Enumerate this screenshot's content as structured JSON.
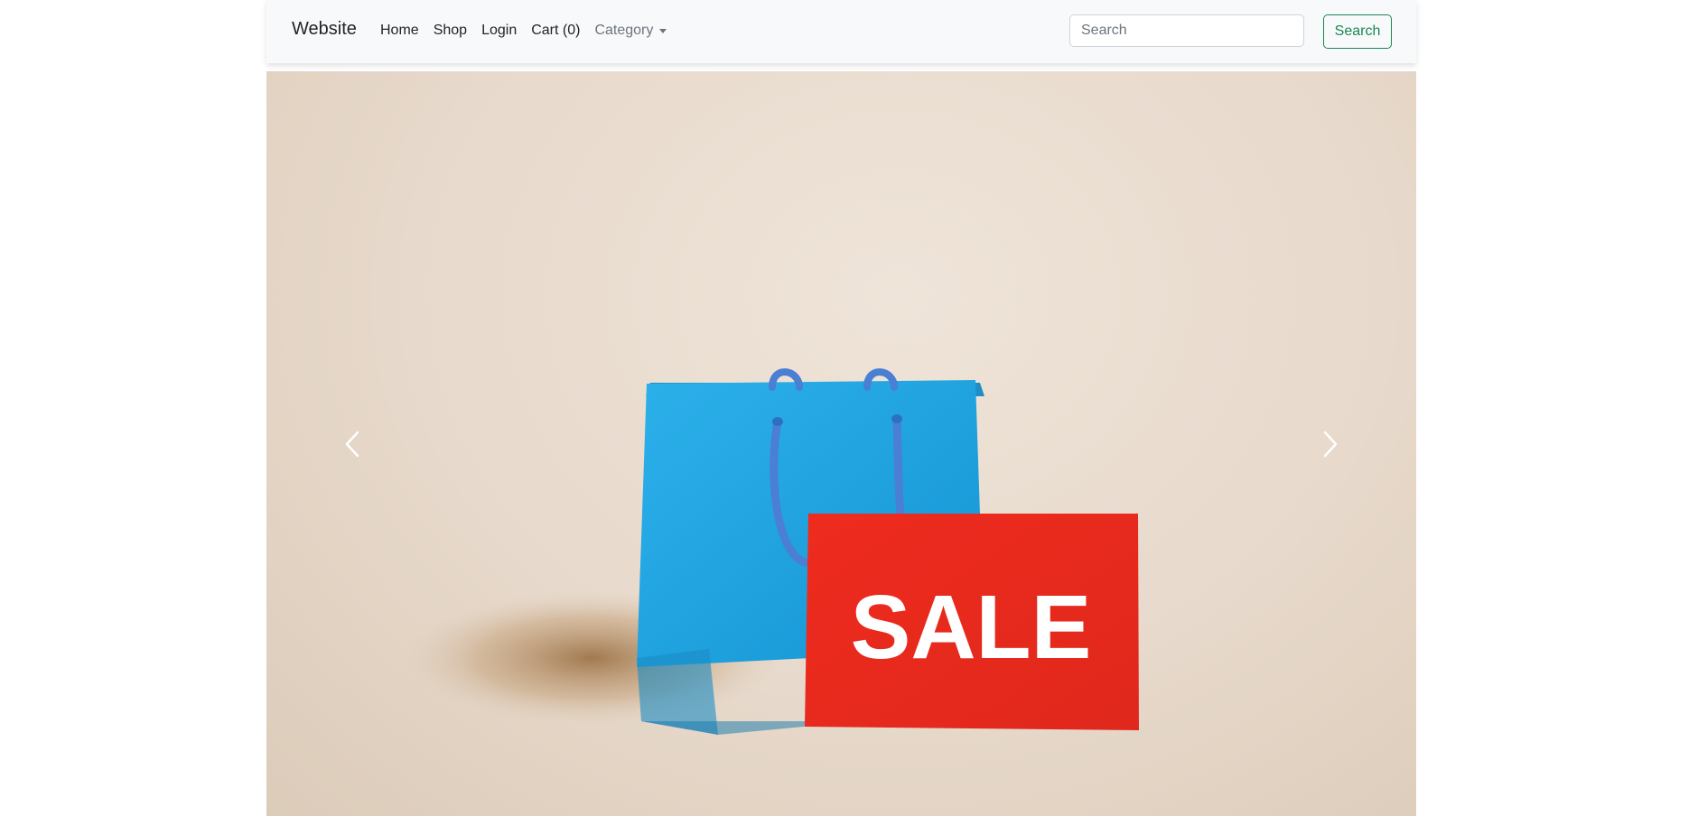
{
  "navbar": {
    "brand": "Website",
    "links": [
      {
        "label": "Home"
      },
      {
        "label": "Shop"
      },
      {
        "label": "Login"
      },
      {
        "label": "Cart (0)"
      }
    ],
    "category_label": "Category",
    "search_placeholder": "Search",
    "search_button": "Search"
  },
  "carousel": {
    "slide_text": "SALE",
    "colors": {
      "bag": "#1ea0dc",
      "sign": "#e8261c",
      "background": "#e9ddd0"
    }
  }
}
